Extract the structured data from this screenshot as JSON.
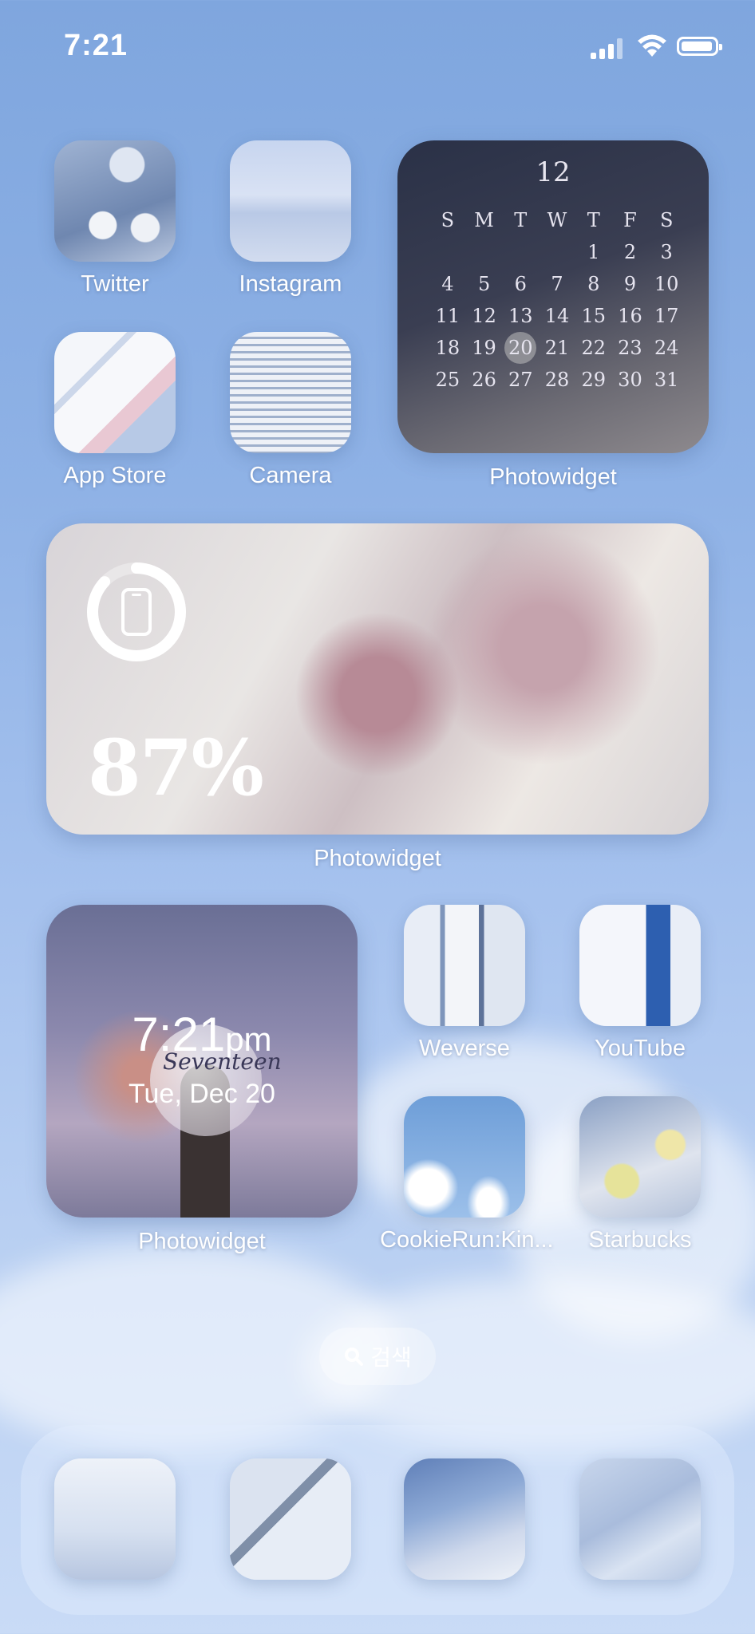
{
  "status_bar": {
    "time": "7:21"
  },
  "apps": {
    "twitter": "Twitter",
    "instagram": "Instagram",
    "app_store": "App Store",
    "camera": "Camera",
    "weverse": "Weverse",
    "youtube": "YouTube",
    "cookierun": "CookieRun:Kin...",
    "starbucks": "Starbucks"
  },
  "calendar_widget": {
    "label": "Photowidget",
    "month": "12",
    "weekdays": [
      "S",
      "M",
      "T",
      "W",
      "T",
      "F",
      "S"
    ],
    "weeks": [
      [
        "",
        "",
        "",
        "",
        "1",
        "2",
        "3"
      ],
      [
        "4",
        "5",
        "6",
        "7",
        "8",
        "9",
        "10"
      ],
      [
        "11",
        "12",
        "13",
        "14",
        "15",
        "16",
        "17"
      ],
      [
        "18",
        "19",
        "20",
        "21",
        "22",
        "23",
        "24"
      ],
      [
        "25",
        "26",
        "27",
        "28",
        "29",
        "30",
        "31"
      ]
    ],
    "today": "20"
  },
  "battery_widget": {
    "label": "Photowidget",
    "percent_text": "87%",
    "level": 0.87
  },
  "clock_widget": {
    "label": "Photowidget",
    "time": "7:21",
    "ampm": "pm",
    "date": "Tue, Dec 20",
    "lightstick_text": "Seventeen"
  },
  "search": {
    "label": "검색"
  },
  "colors": {
    "background": "#8fb2e6",
    "text": "#ffffff"
  }
}
